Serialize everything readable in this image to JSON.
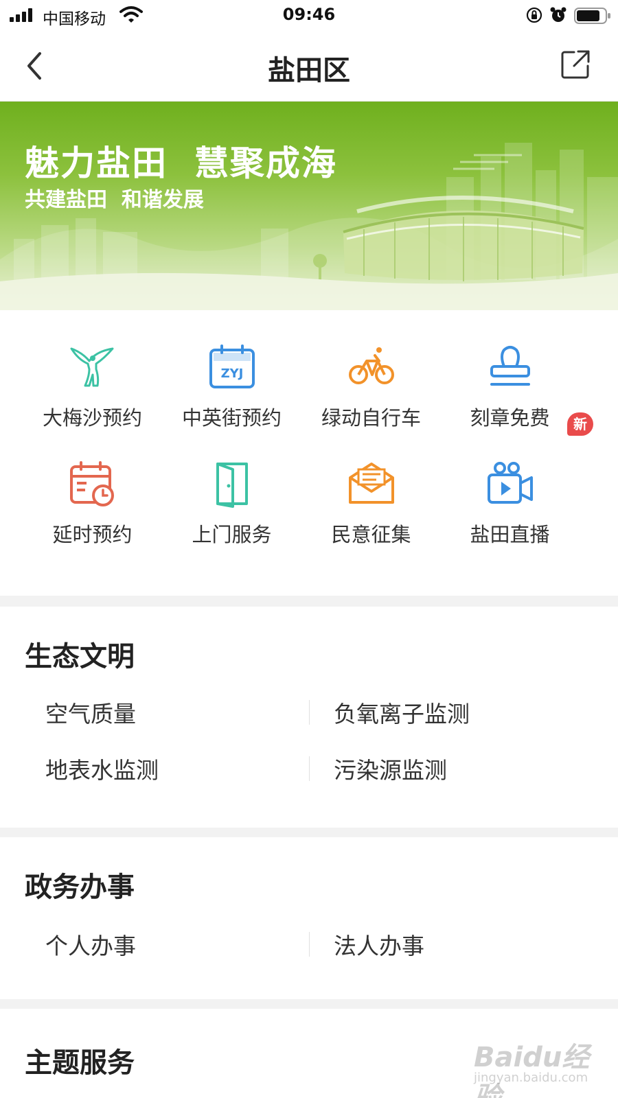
{
  "status_bar": {
    "carrier": "中国移动",
    "time": "09:46"
  },
  "nav": {
    "title": "盐田区"
  },
  "banner": {
    "title": "魅力盐田  慧聚成海",
    "subtitle": "共建盐田  和谐发展"
  },
  "grid": {
    "items": [
      {
        "label": "大梅沙预约",
        "icon": "angel-statue-icon",
        "color": "#3cc2a4"
      },
      {
        "label": "中英街预约",
        "icon": "zyj-calendar-icon",
        "color": "#3b8fe0",
        "icon_text": "ZYJ"
      },
      {
        "label": "绿动自行车",
        "icon": "bicycle-icon",
        "color": "#f2922a"
      },
      {
        "label": "刻章免费",
        "icon": "stamp-icon",
        "color": "#3b8fe0"
      },
      {
        "label": "延时预约",
        "icon": "calendar-clock-icon",
        "color": "#e3674f"
      },
      {
        "label": "上门服务",
        "icon": "door-icon",
        "color": "#3cc2a4"
      },
      {
        "label": "民意征集",
        "icon": "envelope-icon",
        "color": "#f2922a"
      },
      {
        "label": "盐田直播",
        "icon": "video-camera-icon",
        "color": "#3b8fe0"
      }
    ],
    "badge_new": "新"
  },
  "sections": {
    "ecology": {
      "title": "生态文明",
      "items": [
        "空气质量",
        "负氧离子监测",
        "地表水监测",
        "污染源监测"
      ]
    },
    "government": {
      "title": "政务办事",
      "items": [
        "个人办事",
        "法人办事"
      ]
    },
    "theme": {
      "title": "主题服务"
    }
  },
  "watermark": {
    "text": "Baidu经验",
    "url": "jingyan.baidu.com"
  }
}
